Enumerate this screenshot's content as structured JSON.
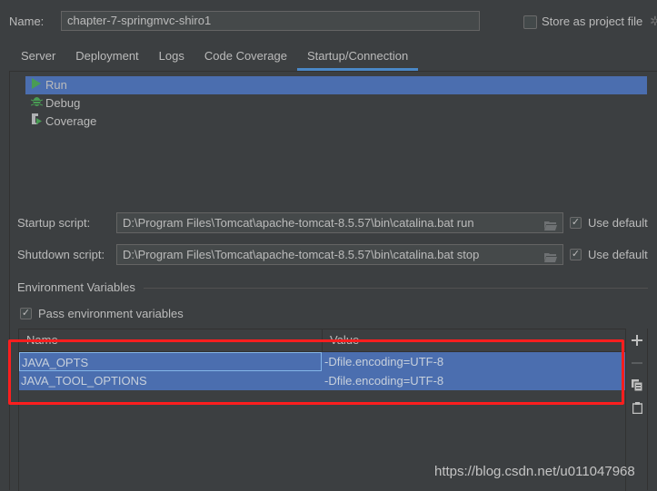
{
  "header": {
    "name_label": "Name:",
    "name_value": "chapter-7-springmvc-shiro1",
    "store_as_project_file": {
      "label": "Store as project file",
      "checked": false
    }
  },
  "tabs": [
    {
      "label": "Server",
      "active": false
    },
    {
      "label": "Deployment",
      "active": false
    },
    {
      "label": "Logs",
      "active": false
    },
    {
      "label": "Code Coverage",
      "active": false
    },
    {
      "label": "Startup/Connection",
      "active": true
    }
  ],
  "executors": [
    {
      "label": "Run",
      "icon": "run-icon",
      "selected": true
    },
    {
      "label": "Debug",
      "icon": "debug-bug-icon",
      "selected": false
    },
    {
      "label": "Coverage",
      "icon": "coverage-icon",
      "selected": false
    }
  ],
  "scripts": {
    "startup": {
      "label": "Startup script:",
      "value": "D:\\Program Files\\Tomcat\\apache-tomcat-8.5.57\\bin\\catalina.bat run",
      "use_default_label": "Use default",
      "use_default": true
    },
    "shutdown": {
      "label": "Shutdown script:",
      "value": "D:\\Program Files\\Tomcat\\apache-tomcat-8.5.57\\bin\\catalina.bat stop",
      "use_default_label": "Use default",
      "use_default": true
    }
  },
  "environment": {
    "title": "Environment Variables",
    "pass_env_label": "Pass environment variables",
    "pass_env": true,
    "columns": [
      "Name",
      "Value"
    ],
    "rows": [
      {
        "name": "JAVA_OPTS",
        "value": "-Dfile.encoding=UTF-8"
      },
      {
        "name": "JAVA_TOOL_OPTIONS",
        "value": "-Dfile.encoding=UTF-8"
      }
    ],
    "tools": [
      "add-icon",
      "remove-icon",
      "copy-icon",
      "paste-icon"
    ]
  },
  "colors": {
    "background": "#3c3f41",
    "selection": "#4b6eaf",
    "tab_underline": "#4a88c7",
    "annotation_box": "#ff1e1e",
    "run_green": "#499c54"
  },
  "watermark": "https://blog.csdn.net/u011047968"
}
